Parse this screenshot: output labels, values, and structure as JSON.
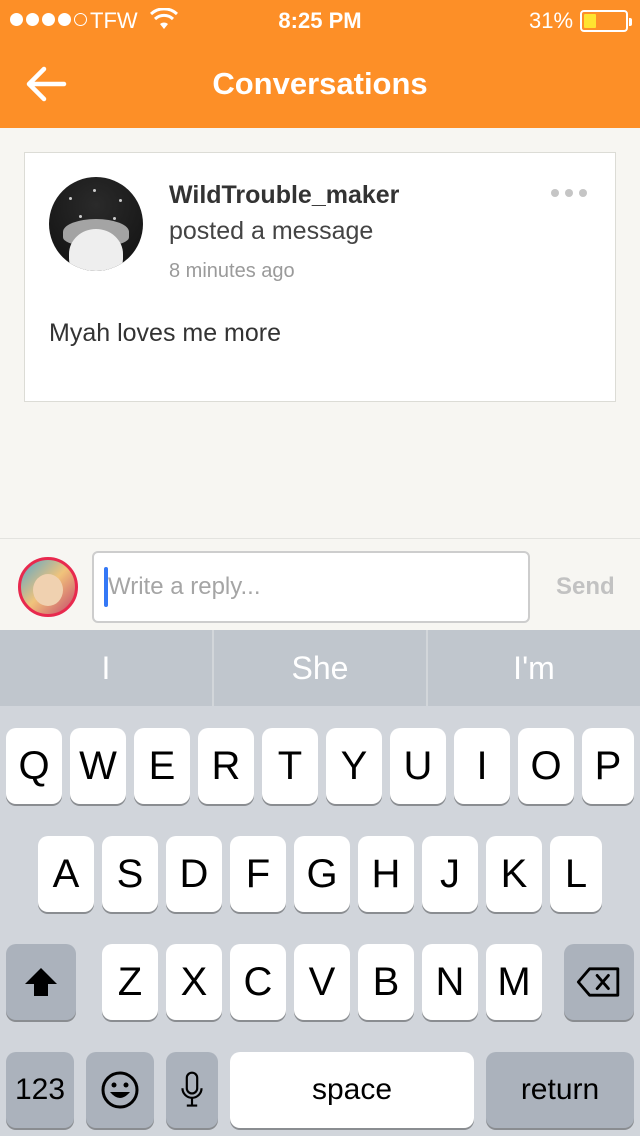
{
  "status_bar": {
    "carrier": "TFW",
    "time": "8:25 PM",
    "battery": "31%",
    "battery_level": 0.31
  },
  "header": {
    "title": "Conversations",
    "back_icon": "back-arrow-icon"
  },
  "post": {
    "username": "WildTrouble_maker",
    "action": "posted a message",
    "time_ago": "8 minutes ago",
    "message": "Myah loves me more",
    "more_icon": "more-options-icon"
  },
  "reply": {
    "placeholder": "Write a reply...",
    "send_label": "Send"
  },
  "keyboard": {
    "suggestions": [
      "I",
      "She",
      "I'm"
    ],
    "row1": [
      "Q",
      "W",
      "E",
      "R",
      "T",
      "Y",
      "U",
      "I",
      "O",
      "P"
    ],
    "row2": [
      "A",
      "S",
      "D",
      "F",
      "G",
      "H",
      "J",
      "K",
      "L"
    ],
    "row3": [
      "Z",
      "X",
      "C",
      "V",
      "B",
      "N",
      "M"
    ],
    "numbers_label": "123",
    "space_label": "space",
    "return_label": "return"
  },
  "colors": {
    "accent": "#fd8f27",
    "caret": "#3478f6"
  }
}
